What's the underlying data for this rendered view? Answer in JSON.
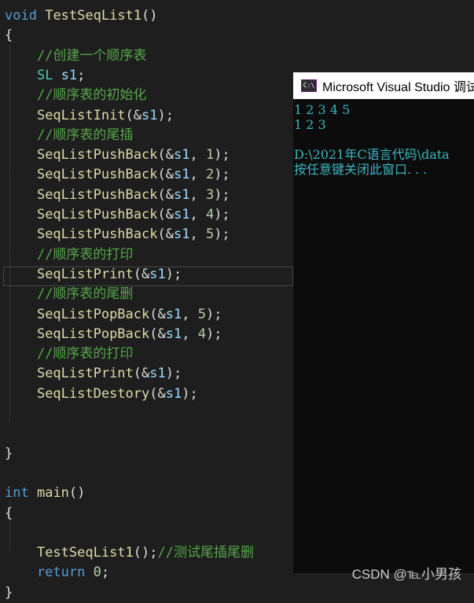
{
  "editor": {
    "lines": [
      {
        "parts": [
          [
            "kw",
            "void"
          ],
          [
            "pn",
            " "
          ],
          [
            "fn",
            "TestSeqList1"
          ],
          [
            "pn",
            "()"
          ]
        ]
      },
      {
        "parts": [
          [
            "pn",
            "{"
          ]
        ]
      },
      {
        "parts": [
          [
            "pn",
            "    "
          ],
          [
            "cm",
            "//创建一个顺序表"
          ]
        ]
      },
      {
        "parts": [
          [
            "pn",
            "    "
          ],
          [
            "ty",
            "SL"
          ],
          [
            "pn",
            " "
          ],
          [
            "vr",
            "s1"
          ],
          [
            "pn",
            ";"
          ]
        ]
      },
      {
        "parts": [
          [
            "pn",
            "    "
          ],
          [
            "cm",
            "//顺序表的初始化"
          ]
        ]
      },
      {
        "parts": [
          [
            "pn",
            "    "
          ],
          [
            "fn",
            "SeqListInit"
          ],
          [
            "pn",
            "(&"
          ],
          [
            "vr",
            "s1"
          ],
          [
            "pn",
            ");"
          ]
        ]
      },
      {
        "parts": [
          [
            "pn",
            "    "
          ],
          [
            "cm",
            "//顺序表的尾插"
          ]
        ]
      },
      {
        "parts": [
          [
            "pn",
            "    "
          ],
          [
            "fn",
            "SeqListPushBack"
          ],
          [
            "pn",
            "(&"
          ],
          [
            "vr",
            "s1"
          ],
          [
            "pn",
            ", "
          ],
          [
            "nm",
            "1"
          ],
          [
            "pn",
            ");"
          ]
        ]
      },
      {
        "parts": [
          [
            "pn",
            "    "
          ],
          [
            "fn",
            "SeqListPushBack"
          ],
          [
            "pn",
            "(&"
          ],
          [
            "vr",
            "s1"
          ],
          [
            "pn",
            ", "
          ],
          [
            "nm",
            "2"
          ],
          [
            "pn",
            ");"
          ]
        ]
      },
      {
        "parts": [
          [
            "pn",
            "    "
          ],
          [
            "fn",
            "SeqListPushBack"
          ],
          [
            "pn",
            "(&"
          ],
          [
            "vr",
            "s1"
          ],
          [
            "pn",
            ", "
          ],
          [
            "nm",
            "3"
          ],
          [
            "pn",
            ");"
          ]
        ]
      },
      {
        "parts": [
          [
            "pn",
            "    "
          ],
          [
            "fn",
            "SeqListPushBack"
          ],
          [
            "pn",
            "(&"
          ],
          [
            "vr",
            "s1"
          ],
          [
            "pn",
            ", "
          ],
          [
            "nm",
            "4"
          ],
          [
            "pn",
            ");"
          ]
        ]
      },
      {
        "parts": [
          [
            "pn",
            "    "
          ],
          [
            "fn",
            "SeqListPushBack"
          ],
          [
            "pn",
            "(&"
          ],
          [
            "vr",
            "s1"
          ],
          [
            "pn",
            ", "
          ],
          [
            "nm",
            "5"
          ],
          [
            "pn",
            ");"
          ]
        ]
      },
      {
        "parts": [
          [
            "pn",
            "    "
          ],
          [
            "cm",
            "//顺序表的打印"
          ]
        ]
      },
      {
        "parts": [
          [
            "pn",
            "    "
          ],
          [
            "fn",
            "SeqListPrint"
          ],
          [
            "pn",
            "(&"
          ],
          [
            "vr",
            "s1"
          ],
          [
            "pn",
            ");"
          ]
        ]
      },
      {
        "parts": [
          [
            "pn",
            "    "
          ],
          [
            "cm",
            "//顺序表的尾删"
          ]
        ]
      },
      {
        "parts": [
          [
            "pn",
            "    "
          ],
          [
            "fn",
            "SeqListPopBack"
          ],
          [
            "pn",
            "(&"
          ],
          [
            "vr",
            "s1"
          ],
          [
            "pn",
            ", "
          ],
          [
            "nm",
            "5"
          ],
          [
            "pn",
            ");"
          ]
        ]
      },
      {
        "parts": [
          [
            "pn",
            "    "
          ],
          [
            "fn",
            "SeqListPopBack"
          ],
          [
            "pn",
            "(&"
          ],
          [
            "vr",
            "s1"
          ],
          [
            "pn",
            ", "
          ],
          [
            "nm",
            "4"
          ],
          [
            "pn",
            ");"
          ]
        ]
      },
      {
        "parts": [
          [
            "pn",
            "    "
          ],
          [
            "cm",
            "//顺序表的打印"
          ]
        ]
      },
      {
        "parts": [
          [
            "pn",
            "    "
          ],
          [
            "fn",
            "SeqListPrint"
          ],
          [
            "pn",
            "(&"
          ],
          [
            "vr",
            "s1"
          ],
          [
            "pn",
            ");"
          ]
        ]
      },
      {
        "parts": [
          [
            "pn",
            "    "
          ],
          [
            "fn",
            "SeqListDestory"
          ],
          [
            "pn",
            "(&"
          ],
          [
            "vr",
            "s1"
          ],
          [
            "pn",
            ");"
          ]
        ]
      },
      {
        "parts": []
      },
      {
        "parts": []
      },
      {
        "parts": [
          [
            "pn",
            "}"
          ]
        ]
      },
      {
        "parts": []
      },
      {
        "parts": [
          [
            "kw",
            "int"
          ],
          [
            "pn",
            " "
          ],
          [
            "fn",
            "main"
          ],
          [
            "pn",
            "()"
          ]
        ]
      },
      {
        "parts": [
          [
            "pn",
            "{"
          ]
        ]
      },
      {
        "parts": []
      },
      {
        "parts": [
          [
            "pn",
            "    "
          ],
          [
            "fn",
            "TestSeqList1"
          ],
          [
            "pn",
            "();"
          ],
          [
            "cm",
            "//测试尾插尾删"
          ]
        ]
      },
      {
        "parts": [
          [
            "pn",
            "    "
          ],
          [
            "kw",
            "return"
          ],
          [
            "pn",
            " "
          ],
          [
            "nm",
            "0"
          ],
          [
            "pn",
            ";"
          ]
        ]
      },
      {
        "parts": [
          [
            "pn",
            "}"
          ]
        ]
      }
    ]
  },
  "console": {
    "title": "Microsoft Visual Studio 调试",
    "icon": "visual-studio-console-icon",
    "icon_text": "C:\\",
    "output": [
      "1 2 3 4 5",
      "1 2 3",
      "",
      "D:\\2021年C语言代码\\data",
      "按任意键关闭此窗口. . ."
    ]
  },
  "watermark": "CSDN @℡小男孩",
  "colors": {
    "background": "#1e1e1e",
    "keyword": "#569cd6",
    "function": "#dcdcaa",
    "comment": "#57a64a",
    "type": "#4ec9b0",
    "variable": "#9cdcfe",
    "number": "#b5cea8",
    "console_text": "#3bb7c2"
  }
}
